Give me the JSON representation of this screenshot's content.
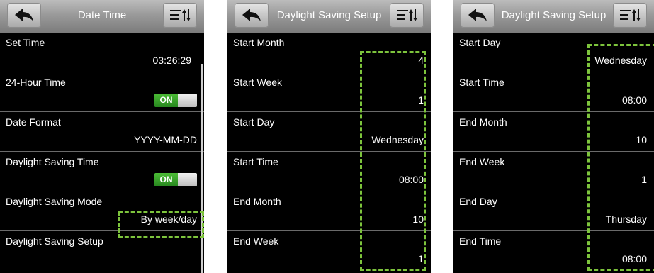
{
  "screen1": {
    "title": "Date Time",
    "rows": [
      {
        "label": "Set Time",
        "value": "03:26:29"
      },
      {
        "label": "24-Hour Time",
        "toggle": "ON"
      },
      {
        "label": "Date Format",
        "value": "YYYY-MM-DD"
      },
      {
        "label": "Daylight Saving Time",
        "toggle": "ON"
      },
      {
        "label": "Daylight Saving Mode",
        "value": "By week/day"
      },
      {
        "label": "Daylight Saving Setup"
      }
    ]
  },
  "screen2": {
    "title": "Daylight Saving Setup",
    "rows": [
      {
        "label": "Start Month",
        "value": "4"
      },
      {
        "label": "Start Week",
        "value": "1"
      },
      {
        "label": "Start Day",
        "value": "Wednesday"
      },
      {
        "label": "Start Time",
        "value": "08:00"
      },
      {
        "label": "End Month",
        "value": "10"
      },
      {
        "label": "End Week",
        "value": "1"
      }
    ]
  },
  "screen3": {
    "title": "Daylight Saving Setup",
    "rows": [
      {
        "label": "Start Day",
        "value": "Wednesday"
      },
      {
        "label": "Start Time",
        "value": "08:00"
      },
      {
        "label": "End Month",
        "value": "10"
      },
      {
        "label": "End Week",
        "value": "1"
      },
      {
        "label": "End Day",
        "value": "Thursday"
      },
      {
        "label": "End Time",
        "value": "08:00"
      }
    ]
  },
  "colors": {
    "highlight_dash": "#7dc43c",
    "toggle_on": "#3fae2e",
    "header_gray": "#9a9a9a",
    "background": "#000000"
  },
  "icons": {
    "back": "back-arrow-icon",
    "menu": "sort-menu-icon"
  }
}
